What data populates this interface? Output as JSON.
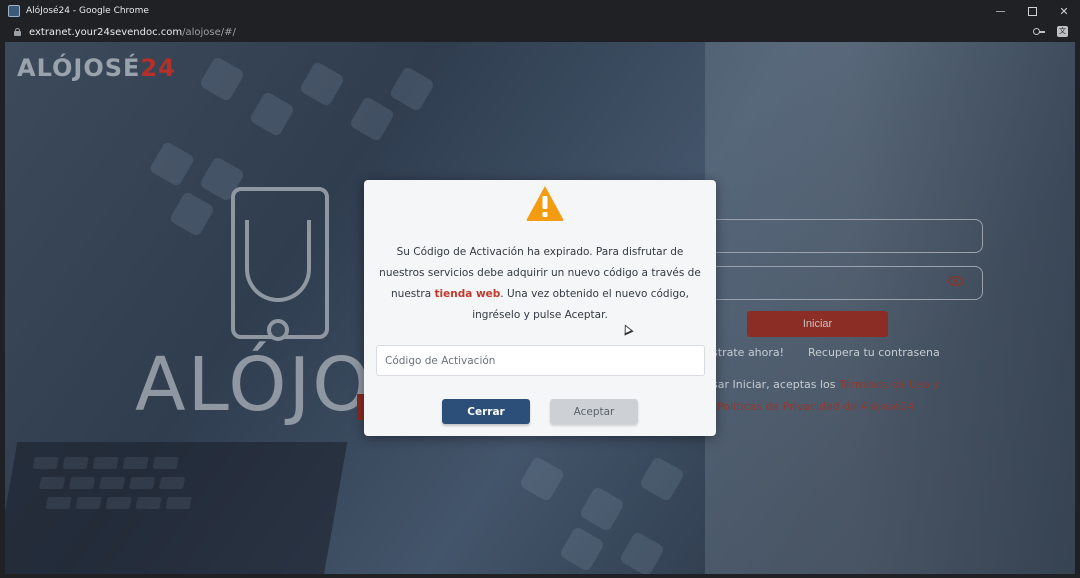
{
  "window": {
    "title": "AlóJosé24 - Google Chrome",
    "controls": [
      "minimize",
      "maximize",
      "close"
    ]
  },
  "address_bar": {
    "url_host": "extranet.your24sevendoc.com",
    "url_path": "/alojose/#/",
    "icons": [
      "key-icon",
      "translate-icon"
    ]
  },
  "site": {
    "logo_text": "ALÓJOSÉ",
    "logo_number": "24",
    "brand_big": "ALÓJOSÉ"
  },
  "login": {
    "iniciar_label": "Iniciar",
    "register_link": "istrate ahora!",
    "recover_link": "Recupera tu contrasena",
    "terms_prefix": "lsar Iniciar, aceptas los ",
    "terms_link": "Términos de Uso y",
    "privacy_link": "Políticas de Privacidad de AlóJosé24"
  },
  "modal": {
    "icon": "warning-icon",
    "message_part1": "Su Código de Activación ha expirado. Para disfrutar de nuestros servicios debe adquirir un nuevo código a través de nuestra ",
    "store_link": "tienda web",
    "message_part2": ". Una vez obtenido el nuevo código, ingréselo y pulse Aceptar.",
    "input_placeholder": "Código de Activación",
    "input_value": "",
    "cerrar_label": "Cerrar",
    "aceptar_label": "Aceptar"
  },
  "colors": {
    "primary_button": "#2c4f79",
    "disabled_button": "#cdd1d6",
    "link_red": "#c0392b",
    "warning": "#f39c12",
    "iniciar": "#8c2d25"
  }
}
